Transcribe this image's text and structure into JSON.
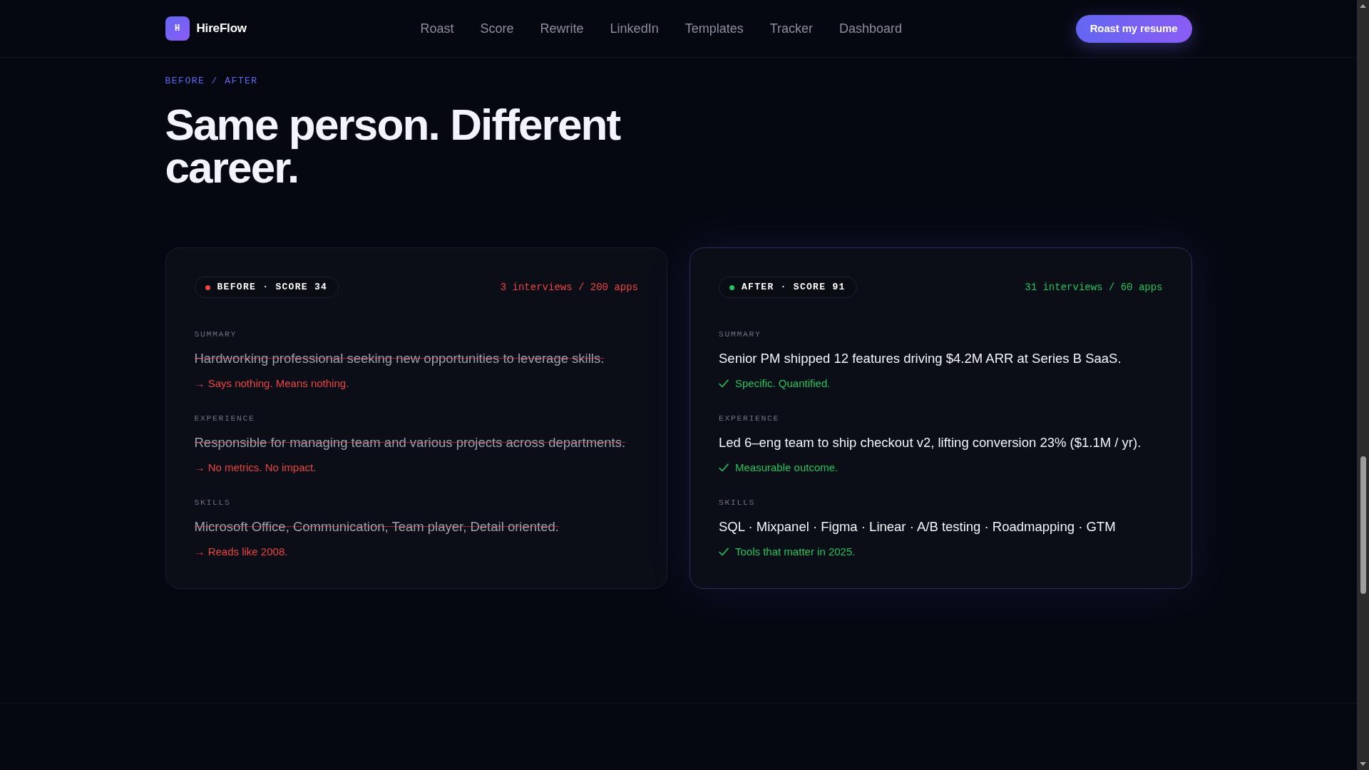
{
  "navbar": {
    "logo_letter": "H",
    "brand": "HireFlow",
    "links": [
      "Roast",
      "Score",
      "Rewrite",
      "LinkedIn",
      "Templates",
      "Tracker",
      "Dashboard"
    ],
    "cta": "Roast my resume"
  },
  "section": {
    "eyebrow": "BEFORE / AFTER",
    "title": "Same person. Different career.",
    "cards": [
      {
        "kind": "before",
        "badge": "BEFORE · SCORE 34",
        "stat": "3 interviews / 200 apps",
        "fields": [
          {
            "label": "SUMMARY",
            "text": "Hardworking professional seeking new opportunities to leverage skills.",
            "note": "→ Says nothing. Means nothing."
          },
          {
            "label": "EXPERIENCE",
            "text": "Responsible for managing team and various projects across departments.",
            "note": "→ No metrics. No impact."
          },
          {
            "label": "SKILLS",
            "text": "Microsoft Office, Communication, Team player, Detail oriented.",
            "note": "→ Reads like 2008."
          }
        ]
      },
      {
        "kind": "after",
        "badge": "AFTER · SCORE 91",
        "stat": "31 interviews / 60 apps",
        "fields": [
          {
            "label": "SUMMARY",
            "text": "Senior PM shipped 12 features driving $4.2M ARR at Series B SaaS.",
            "note": "Specific. Quantified."
          },
          {
            "label": "EXPERIENCE",
            "text": "Led 6–eng team to ship checkout v2, lifting conversion 23% ($1.1M / yr).",
            "note": "Measurable outcome."
          },
          {
            "label": "SKILLS",
            "text": "SQL · Mixpanel · Figma · Linear · A/B testing · Roadmapping · GTM",
            "note": "Tools that matter in 2025."
          }
        ]
      }
    ]
  }
}
